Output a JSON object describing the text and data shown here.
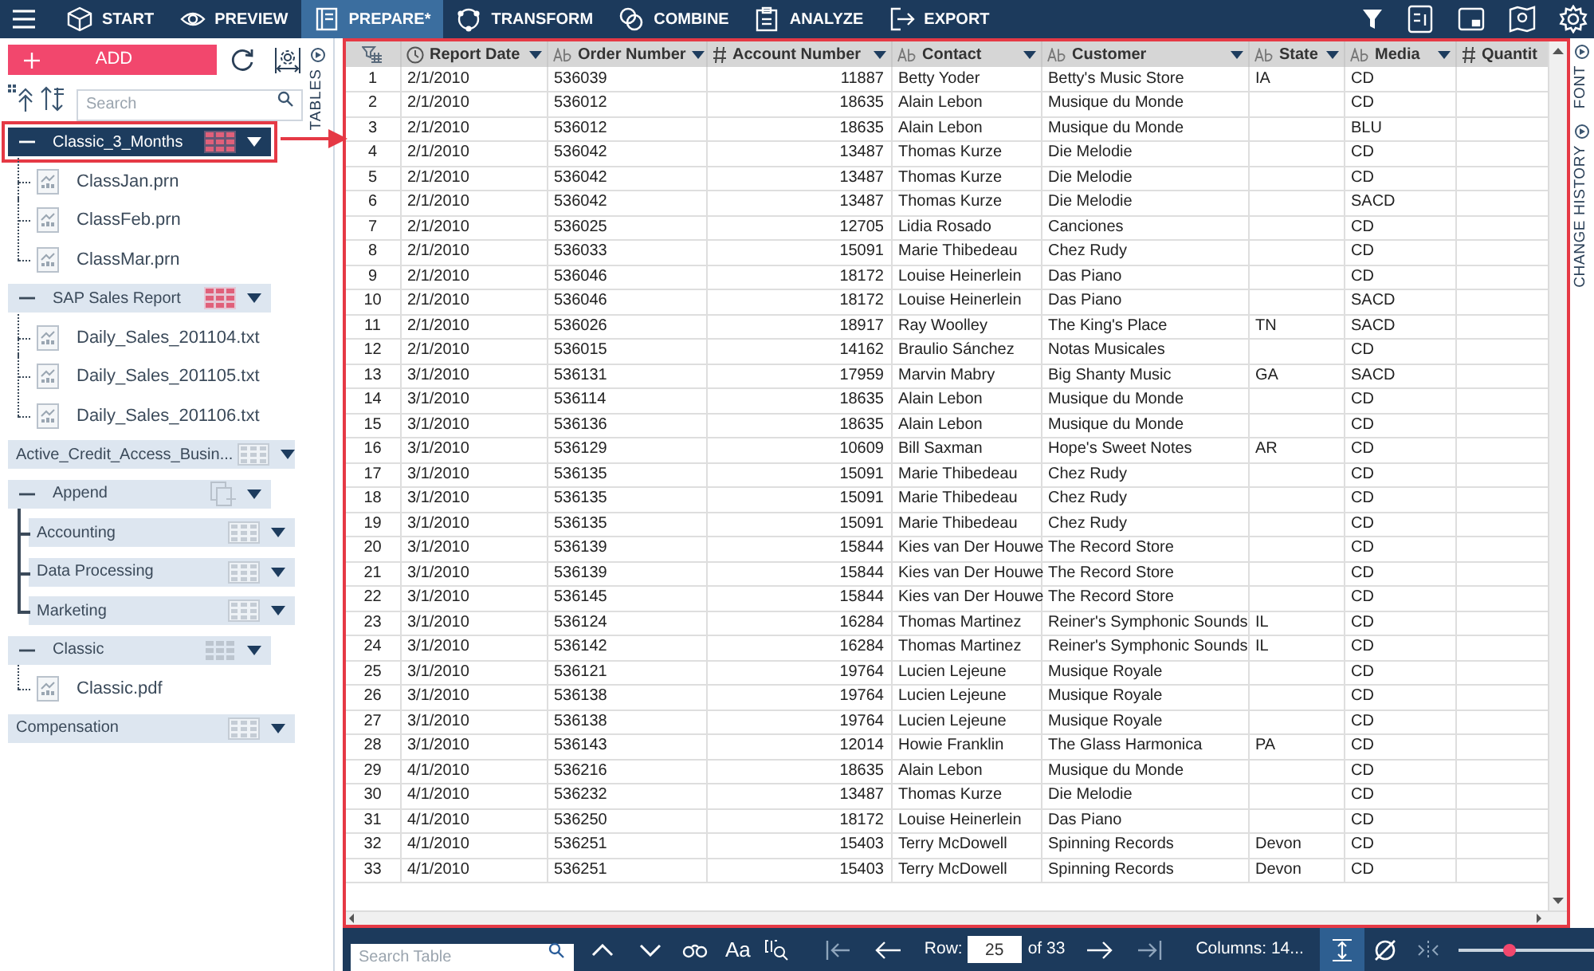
{
  "menu_bar": {
    "tabs": [
      {
        "label": "START",
        "selected": false
      },
      {
        "label": "PREVIEW",
        "selected": false
      },
      {
        "label": "PREPARE*",
        "selected": true
      },
      {
        "label": "TRANSFORM",
        "selected": false
      },
      {
        "label": "COMBINE",
        "selected": false
      },
      {
        "label": "ANALYZE",
        "selected": false
      },
      {
        "label": "EXPORT",
        "selected": false
      }
    ]
  },
  "sidebar": {
    "add_button": "ADD",
    "search": {
      "placeholder": "Search"
    },
    "panel_tab": "TABLES",
    "tree": [
      {
        "label": "Classic_3_Months",
        "kind": "multi",
        "expanded": true,
        "selected": true,
        "children": [
          {
            "label": "ClassJan.prn",
            "kind": "file"
          },
          {
            "label": "ClassFeb.prn",
            "kind": "file"
          },
          {
            "label": "ClassMar.prn",
            "kind": "file"
          }
        ]
      },
      {
        "label": "SAP Sales Report",
        "kind": "multi",
        "expanded": true,
        "selected": false,
        "children": [
          {
            "label": "Daily_Sales_201104.txt",
            "kind": "file"
          },
          {
            "label": "Daily_Sales_201105.txt",
            "kind": "file"
          },
          {
            "label": "Daily_Sales_201106.txt",
            "kind": "file"
          }
        ]
      },
      {
        "label": "Active_Credit_Access_Busin...",
        "kind": "table",
        "expanded": false,
        "selected": false
      },
      {
        "label": "Append",
        "kind": "append",
        "expanded": true,
        "selected": false,
        "children": [
          {
            "label": "Accounting",
            "kind": "table",
            "expanded": false,
            "selected": false
          },
          {
            "label": "Data Processing",
            "kind": "table",
            "expanded": false,
            "selected": false
          },
          {
            "label": "Marketing",
            "kind": "table",
            "expanded": false,
            "selected": false
          }
        ]
      },
      {
        "label": "Classic",
        "kind": "pdf",
        "expanded": true,
        "selected": false,
        "children": [
          {
            "label": "Classic.pdf",
            "kind": "file"
          }
        ]
      },
      {
        "label": "Compensation",
        "kind": "table",
        "expanded": false,
        "selected": false
      }
    ]
  },
  "table": {
    "columns": [
      {
        "kind": "index"
      },
      {
        "label": "Report Date",
        "kind": "date"
      },
      {
        "label": "Order Number",
        "kind": "text"
      },
      {
        "label": "Account Number",
        "kind": "number"
      },
      {
        "label": "Contact",
        "kind": "text"
      },
      {
        "label": "Customer",
        "kind": "text"
      },
      {
        "label": "State",
        "kind": "text"
      },
      {
        "label": "Media",
        "kind": "text"
      },
      {
        "label": "Quantit",
        "kind": "number"
      }
    ],
    "rows": [
      [
        "1",
        "2/1/2010",
        "536039",
        "11887",
        "Betty Yoder",
        "Betty's Music Store",
        "IA",
        "CD"
      ],
      [
        "2",
        "2/1/2010",
        "536012",
        "18635",
        "Alain Lebon",
        "Musique du Monde",
        "",
        "CD"
      ],
      [
        "3",
        "2/1/2010",
        "536012",
        "18635",
        "Alain Lebon",
        "Musique du Monde",
        "",
        "BLU"
      ],
      [
        "4",
        "2/1/2010",
        "536042",
        "13487",
        "Thomas Kurze",
        "Die Melodie",
        "",
        "CD"
      ],
      [
        "5",
        "2/1/2010",
        "536042",
        "13487",
        "Thomas Kurze",
        "Die Melodie",
        "",
        "CD"
      ],
      [
        "6",
        "2/1/2010",
        "536042",
        "13487",
        "Thomas Kurze",
        "Die Melodie",
        "",
        "SACD"
      ],
      [
        "7",
        "2/1/2010",
        "536025",
        "12705",
        "Lidia Rosado",
        "Canciones",
        "",
        "CD"
      ],
      [
        "8",
        "2/1/2010",
        "536033",
        "15091",
        "Marie Thibedeau",
        "Chez Rudy",
        "",
        "CD"
      ],
      [
        "9",
        "2/1/2010",
        "536046",
        "18172",
        "Louise Heinerlein",
        "Das Piano",
        "",
        "CD"
      ],
      [
        "10",
        "2/1/2010",
        "536046",
        "18172",
        "Louise Heinerlein",
        "Das Piano",
        "",
        "SACD"
      ],
      [
        "11",
        "2/1/2010",
        "536026",
        "18917",
        "Ray Woolley",
        "The King's Place",
        "TN",
        "SACD"
      ],
      [
        "12",
        "2/1/2010",
        "536015",
        "14162",
        "Braulio Sánchez",
        "Notas Musicales",
        "",
        "CD"
      ],
      [
        "13",
        "3/1/2010",
        "536131",
        "17959",
        "Marvin Mabry",
        "Big Shanty Music",
        "GA",
        "SACD"
      ],
      [
        "14",
        "3/1/2010",
        "536114",
        "18635",
        "Alain Lebon",
        "Musique du Monde",
        "",
        "CD"
      ],
      [
        "15",
        "3/1/2010",
        "536136",
        "18635",
        "Alain Lebon",
        "Musique du Monde",
        "",
        "CD"
      ],
      [
        "16",
        "3/1/2010",
        "536129",
        "10609",
        "Bill Saxman",
        "Hope's Sweet Notes",
        "AR",
        "CD"
      ],
      [
        "17",
        "3/1/2010",
        "536135",
        "15091",
        "Marie Thibedeau",
        "Chez Rudy",
        "",
        "CD"
      ],
      [
        "18",
        "3/1/2010",
        "536135",
        "15091",
        "Marie Thibedeau",
        "Chez Rudy",
        "",
        "CD"
      ],
      [
        "19",
        "3/1/2010",
        "536135",
        "15091",
        "Marie Thibedeau",
        "Chez Rudy",
        "",
        "CD"
      ],
      [
        "20",
        "3/1/2010",
        "536139",
        "15844",
        "Kies van Der Houwe",
        "The Record Store",
        "",
        "CD"
      ],
      [
        "21",
        "3/1/2010",
        "536139",
        "15844",
        "Kies van Der Houwe",
        "The Record Store",
        "",
        "CD"
      ],
      [
        "22",
        "3/1/2010",
        "536145",
        "15844",
        "Kies van Der Houwe",
        "The Record Store",
        "",
        "CD"
      ],
      [
        "23",
        "3/1/2010",
        "536124",
        "16284",
        "Thomas Martinez",
        "Reiner's Symphonic Sounds",
        "IL",
        "CD"
      ],
      [
        "24",
        "3/1/2010",
        "536142",
        "16284",
        "Thomas Martinez",
        "Reiner's Symphonic Sounds",
        "IL",
        "CD"
      ],
      [
        "25",
        "3/1/2010",
        "536121",
        "19764",
        "Lucien Lejeune",
        "Musique Royale",
        "",
        "CD"
      ],
      [
        "26",
        "3/1/2010",
        "536138",
        "19764",
        "Lucien Lejeune",
        "Musique Royale",
        "",
        "CD"
      ],
      [
        "27",
        "3/1/2010",
        "536138",
        "19764",
        "Lucien Lejeune",
        "Musique Royale",
        "",
        "CD"
      ],
      [
        "28",
        "3/1/2010",
        "536143",
        "12014",
        "Howie Franklin",
        "The Glass Harmonica",
        "PA",
        "CD"
      ],
      [
        "29",
        "4/1/2010",
        "536216",
        "18635",
        "Alain Lebon",
        "Musique du Monde",
        "",
        "CD"
      ],
      [
        "30",
        "4/1/2010",
        "536232",
        "13487",
        "Thomas Kurze",
        "Die Melodie",
        "",
        "CD"
      ],
      [
        "31",
        "4/1/2010",
        "536250",
        "18172",
        "Louise Heinerlein",
        "Das Piano",
        "",
        "CD"
      ],
      [
        "32",
        "4/1/2010",
        "536251",
        "15403",
        "Terry McDowell",
        "Spinning Records",
        "Devon",
        "CD"
      ],
      [
        "33",
        "4/1/2010",
        "536251",
        "15403",
        "Terry McDowell",
        "Spinning Records",
        "Devon",
        "CD"
      ]
    ]
  },
  "right_panel": {
    "tabs": [
      "FONT",
      "CHANGE HISTORY"
    ]
  },
  "bottom_bar": {
    "search": {
      "placeholder": "Search Table"
    },
    "case_button": "Aa",
    "row_label": "Row:",
    "row_value": "25",
    "row_total": "of 33",
    "columns_label": "Columns: 14...",
    "zoom": {
      "level": 0.38
    }
  }
}
